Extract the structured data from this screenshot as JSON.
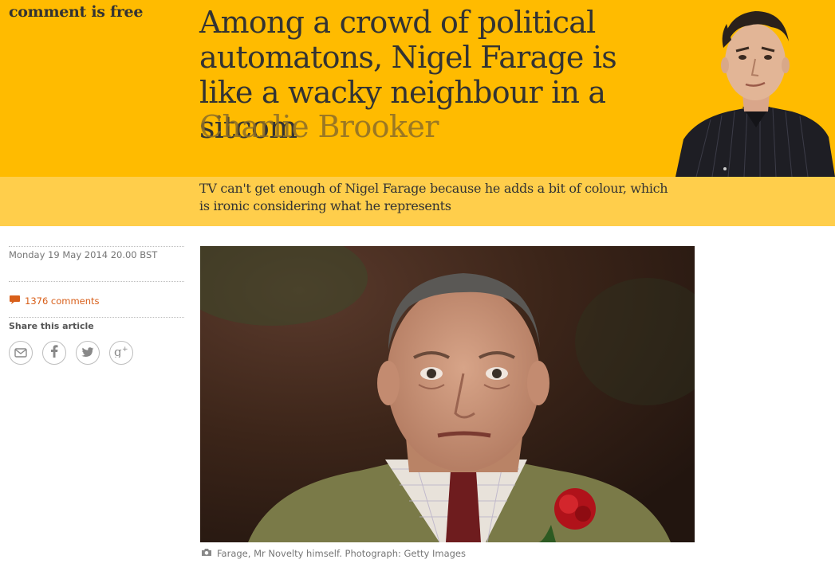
{
  "section": {
    "title": "comment is free"
  },
  "article": {
    "headline": "Among a crowd of political automatons, Nigel Farage is like a wacky neighbour in a sitcom",
    "byline": "Charlie Brooker",
    "standfirst": "TV can't get enough of Nigel Farage because he adds a bit of colour, which is ironic considering what he represents"
  },
  "meta": {
    "dateline": "Monday 19 May 2014 20.00 BST",
    "comments_label": "1376 comments",
    "share_label": "Share this article"
  },
  "share_buttons": [
    {
      "icon": "email-icon"
    },
    {
      "icon": "facebook-icon"
    },
    {
      "icon": "twitter-icon"
    },
    {
      "icon": "google-plus-icon"
    }
  ],
  "image": {
    "caption": "Farage, Mr Novelty himself. Photograph: Getty Images"
  },
  "colors": {
    "header_bg": "#ffbb00",
    "standfirst_bg": "#ffce4b",
    "accent": "#d85f1a",
    "text": "#333333"
  }
}
